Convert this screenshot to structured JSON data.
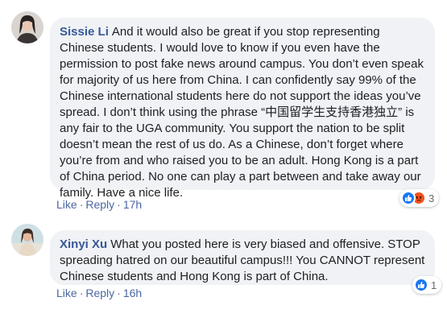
{
  "comments": [
    {
      "author": "Sissie Li",
      "text": "And it would also be great if you stop representing Chinese students. I would love to know if you even have the permission to post fake news around campus. You don’t even speak for majority of us here from China. I can confidently say 99% of the Chinese international students here do not support the ideas you’ve spread. I don’t think using the phrase “中国留学生支持香港独立” is any fair to the UGA community. You support the nation to be split doesn’t mean the rest of us do. As a Chinese, don’t forget where you’re from and who raised you to be an adult. Hong Kong is a part of China period. No one can play a part between and take away our family. Have a nice life.",
      "like_label": "Like",
      "reply_label": "Reply",
      "separator": "·",
      "time": "17h",
      "reaction_count": "3",
      "reaction_icons": [
        "like-icon",
        "angry-icon"
      ]
    },
    {
      "author": "Xinyi Xu",
      "text": "What you posted here is very biased and offensive. STOP spreading hatred on our beautiful campus!!! You CANNOT represent Chinese students and Hong Kong is part of China.",
      "like_label": "Like",
      "reply_label": "Reply",
      "separator": "·",
      "time": "16h",
      "reaction_count": "1",
      "reaction_icons": [
        "like-icon"
      ]
    }
  ],
  "colors": {
    "author": "#385898",
    "bubble": "#f0f2f5",
    "link": "#4b67a1",
    "like_blue": "#1877f2",
    "angry_orange": "#f4511e"
  }
}
